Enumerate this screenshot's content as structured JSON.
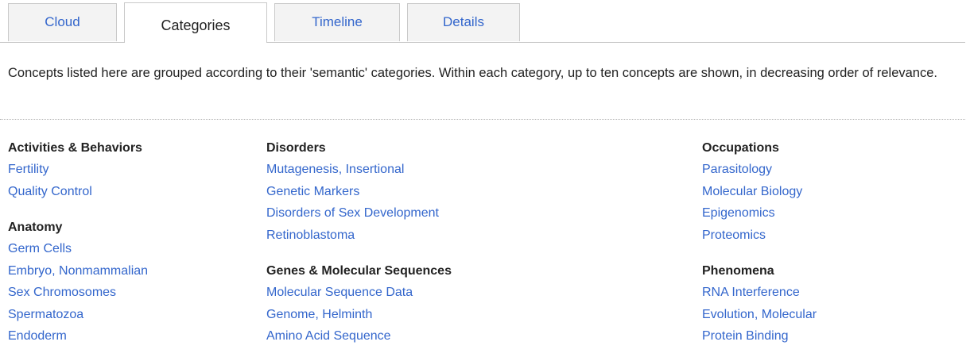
{
  "tabs": [
    {
      "label": "Cloud"
    },
    {
      "label": "Categories"
    },
    {
      "label": "Timeline"
    },
    {
      "label": "Details"
    }
  ],
  "intro": "Concepts listed here are grouped according to their 'semantic' categories. Within each category, up to ten concepts are shown, in decreasing order of relevance.",
  "categories": {
    "activities": {
      "title": "Activities & Behaviors",
      "items": [
        "Fertility",
        "Quality Control"
      ]
    },
    "anatomy": {
      "title": "Anatomy",
      "items": [
        "Germ Cells",
        "Embryo, Nonmammalian",
        "Sex Chromosomes",
        "Spermatozoa",
        "Endoderm"
      ]
    },
    "disorders": {
      "title": "Disorders",
      "items": [
        "Mutagenesis, Insertional",
        "Genetic Markers",
        "Disorders of Sex Development",
        "Retinoblastoma"
      ]
    },
    "genes": {
      "title": "Genes & Molecular Sequences",
      "items": [
        "Molecular Sequence Data",
        "Genome, Helminth",
        "Amino Acid Sequence"
      ]
    },
    "occupations": {
      "title": "Occupations",
      "items": [
        "Parasitology",
        "Molecular Biology",
        "Epigenomics",
        "Proteomics"
      ]
    },
    "phenomena": {
      "title": "Phenomena",
      "items": [
        "RNA Interference",
        "Evolution, Molecular",
        "Protein Binding"
      ]
    }
  },
  "colors": {
    "link": "#3366cc",
    "text": "#222222",
    "tab_bg": "#f3f3f3",
    "border": "#c9c9c9"
  }
}
